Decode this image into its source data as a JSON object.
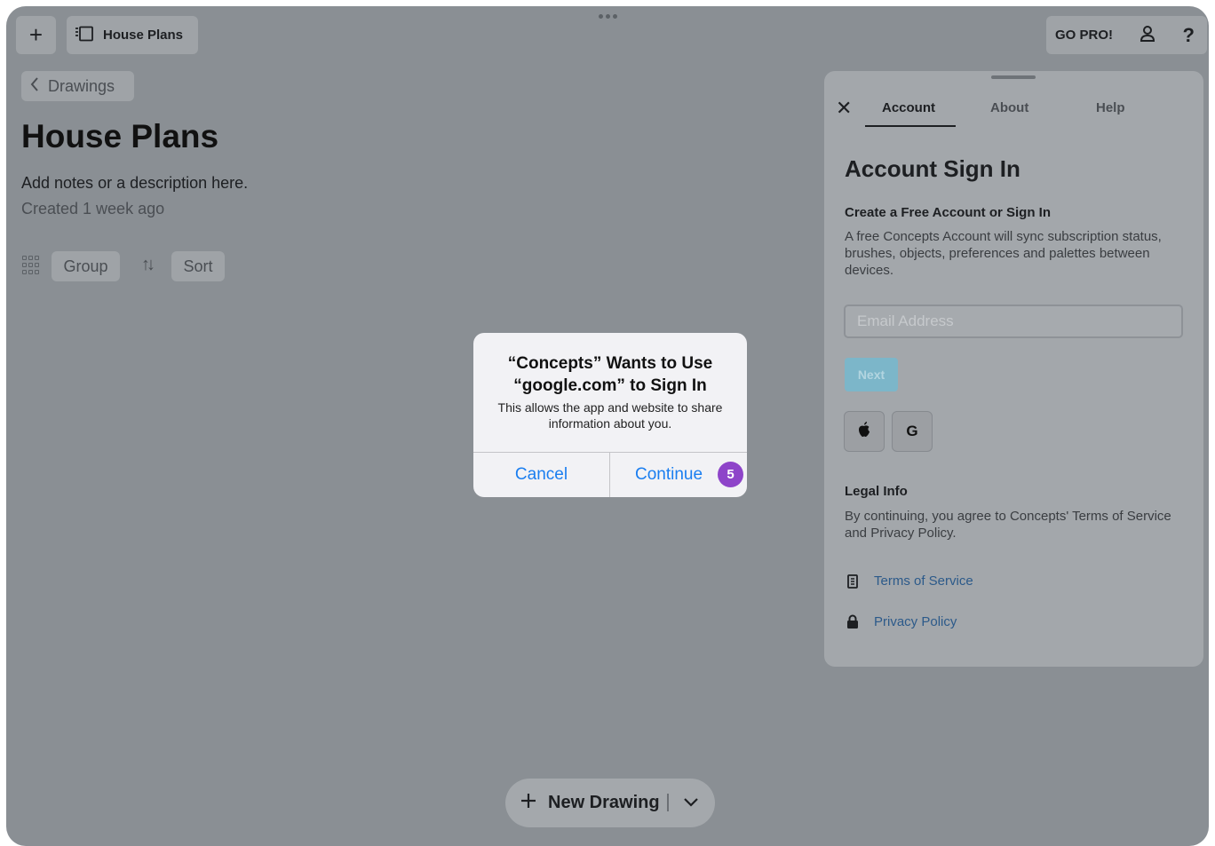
{
  "toolbar": {
    "document_title": "House Plans",
    "go_pro_label": "GO PRO!",
    "help_label": "?"
  },
  "header": {
    "back_label": "Drawings",
    "title": "House Plans",
    "description": "Add notes or a description here.",
    "created": "Created 1 week ago",
    "group_label": "Group",
    "sort_label": "Sort"
  },
  "panel": {
    "tabs": [
      {
        "label": "Account",
        "active": true
      },
      {
        "label": "About",
        "active": false
      },
      {
        "label": "Help",
        "active": false
      }
    ],
    "title": "Account Sign In",
    "subtitle": "Create a Free Account or Sign In",
    "body": "A free Concepts Account will sync subscription status, brushes, objects, preferences and palettes between devices.",
    "email_placeholder": "Email Address",
    "next_label": "Next",
    "google_label": "G",
    "legal_title": "Legal Info",
    "legal_body": "By continuing, you agree to Concepts' Terms of Service and Privacy Policy.",
    "terms_label": "Terms of Service",
    "privacy_label": "Privacy Policy"
  },
  "alert": {
    "title_line1": "“Concepts” Wants to Use",
    "title_line2": "“google.com” to Sign In",
    "message": "This allows the app and website to share information about you.",
    "cancel_label": "Cancel",
    "continue_label": "Continue",
    "step_badge": "5"
  },
  "bottom": {
    "new_drawing_label": "New Drawing"
  },
  "colors": {
    "overlay": "#8a8f94",
    "alert_action": "#1a7ef0",
    "badge": "#8e44c9",
    "next_button": "#7cb6c9"
  }
}
